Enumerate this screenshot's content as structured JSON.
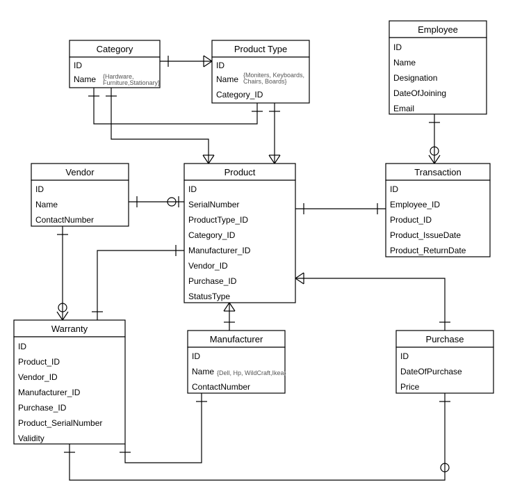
{
  "entities": {
    "category": {
      "title": "Category",
      "attrs": [
        "ID",
        "Name"
      ],
      "note": "{Hardware, Furniture,Stationary}"
    },
    "productType": {
      "title": "Product Type",
      "attrs": [
        "ID",
        "Name",
        "Category_ID"
      ],
      "note": "{Moniters, Keyboards, Chairs, Boards}"
    },
    "employee": {
      "title": "Employee",
      "attrs": [
        "ID",
        "Name",
        "Designation",
        "DateOfJoining",
        "Email"
      ]
    },
    "vendor": {
      "title": "Vendor",
      "attrs": [
        "ID",
        "Name",
        "ContactNumber"
      ]
    },
    "product": {
      "title": "Product",
      "attrs": [
        "ID",
        "SerialNumber",
        "ProductType_ID",
        "Category_ID",
        "Manufacturer_ID",
        "Vendor_ID",
        "Purchase_ID",
        "StatusType"
      ]
    },
    "transaction": {
      "title": "Transaction",
      "attrs": [
        "ID",
        "Employee_ID",
        "Product_ID",
        "Product_IssueDate",
        "Product_ReturnDate"
      ]
    },
    "warranty": {
      "title": "Warranty",
      "attrs": [
        "ID",
        "Product_ID",
        "Vendor_ID",
        "Manufacturer_ID",
        "Purchase_ID",
        "Product_SerialNumber",
        "Validity"
      ]
    },
    "manufacturer": {
      "title": "Manufacturer",
      "attrs": [
        "ID",
        "Name",
        "ContactNumber"
      ],
      "note": "{Dell, Hp, WildCraft,Ikea}"
    },
    "purchase": {
      "title": "Purchase",
      "attrs": [
        "ID",
        "DateOfPurchase",
        "Price"
      ]
    }
  }
}
